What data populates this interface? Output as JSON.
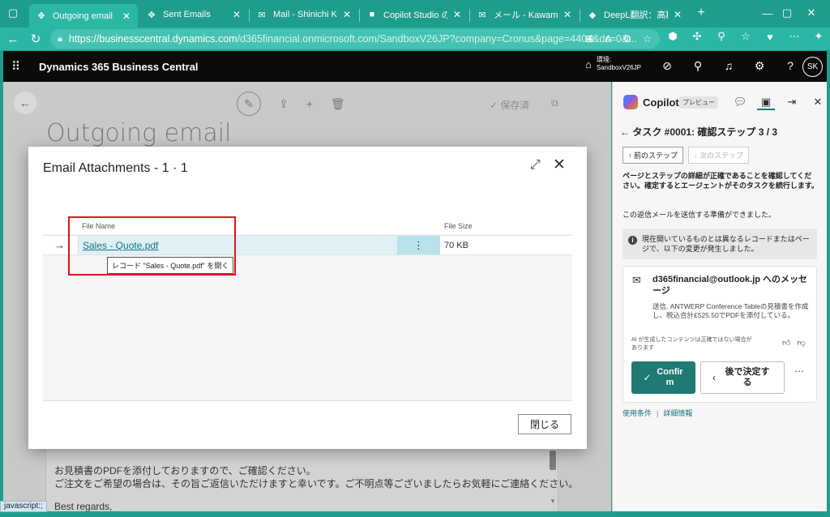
{
  "browser": {
    "tabs": [
      {
        "title": "Outgoing email",
        "active": true
      },
      {
        "title": "Sent Emails"
      },
      {
        "title": "Mail - Shinichi Kawamura"
      },
      {
        "title": "Copilot Studio のライ"
      },
      {
        "title": "メール - Kawamura Sh"
      },
      {
        "title": "DeepL翻訳：高精度"
      }
    ],
    "url_host": "https://businesscentral.dynamics.com",
    "url_path": "/d365financial.onmicrosoft.com/SandboxV26JP?company=Cronus&page=4404&dc=0&..."
  },
  "bc_header": {
    "product": "Dynamics 365 Business Central",
    "env_label": "環境:",
    "env_name": "SandboxV26JP",
    "avatar_initials": "SK"
  },
  "page": {
    "title": "Outgoing email",
    "saved_label": "保存済",
    "body_lines": [
      "お見積書のPDFを添付しておりますので、ご確認ください。",
      "ご注文をご希望の場合は、その旨ご返信いただけますと幸いです。ご不明点等ございましたらお気軽にご連絡ください。",
      "Best regards,"
    ],
    "status_bar": "javascript:;"
  },
  "dialog": {
    "title": "Email Attachments - 1 · 1",
    "columns": {
      "file_name": "File Name",
      "file_size": "File Size"
    },
    "rows": [
      {
        "file_name": "Sales - Quote.pdf",
        "file_size": "70 KB"
      }
    ],
    "tooltip": "レコード \"Sales - Quote.pdf\" を開く",
    "close_button": "閉じる"
  },
  "copilot": {
    "name": "Copilot",
    "badge": "プレビュー",
    "task": "タスク #0001: 確認ステップ 3 / 3",
    "prev_step": "前のステップ",
    "next_step": "次のステップ",
    "instruction": "ページとステップの詳細が正確であることを確認してください。確定するとエージェントがそのタスクを続行します。",
    "ready": "この返信メールを送信する準備ができました。",
    "info": "現在開いているものとは異なるレコードまたはページで、以下の変更が発生しました。",
    "card": {
      "title": "d365financial@outlook.jp へのメッセージ",
      "description": "送信, ANTWERP Conference Tableの見積書を作成し、税込合計£525.50でPDFを添付している。",
      "disclaimer": "AI が生成したコンテンツは正確ではない場合があります",
      "confirm": "Confirm",
      "later": "後で決定する"
    },
    "links": {
      "terms": "使用条件",
      "info": "詳細情報"
    }
  },
  "colors": {
    "edge_tab": "#1f9d8c",
    "bc_header": "#0b0b0b",
    "confirm_button": "#1f7a73",
    "link": "#14737d",
    "highlight_box": "#e1141a"
  }
}
